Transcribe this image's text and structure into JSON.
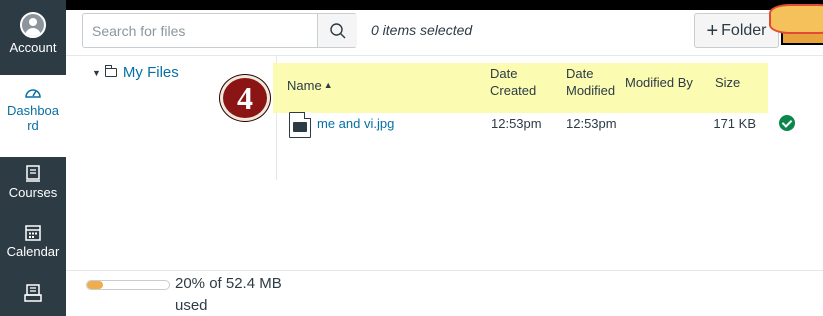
{
  "nav": {
    "account": "Account",
    "dashboard": "Dashboard",
    "dashboard_line1": "Dashboa",
    "dashboard_line2": "rd",
    "courses": "Courses",
    "calendar": "Calendar"
  },
  "toolbar": {
    "search_placeholder": "Search for files",
    "selected_count": "0 items selected",
    "folder_button": "Folder"
  },
  "tree": {
    "root_label": "My Files"
  },
  "annotation": {
    "step_number": "4"
  },
  "table": {
    "headers": {
      "name": "Name",
      "date_created_1": "Date",
      "date_created_2": "Created",
      "date_modified_1": "Date",
      "date_modified_2": "Modified",
      "modified_by": "Modified By",
      "size": "Size"
    },
    "rows": [
      {
        "name": "me and vi.jpg",
        "date_created": "12:53pm",
        "date_modified": "12:53pm",
        "modified_by": "",
        "size": "171 KB",
        "published": true
      }
    ]
  },
  "quota": {
    "text": "20% of 52.4 MB used",
    "percent_used": 20
  },
  "colors": {
    "accent": "#0770a3",
    "highlight": "#fbfbaa",
    "quota_fill": "#f0ad4e",
    "published": "#0b874b"
  }
}
